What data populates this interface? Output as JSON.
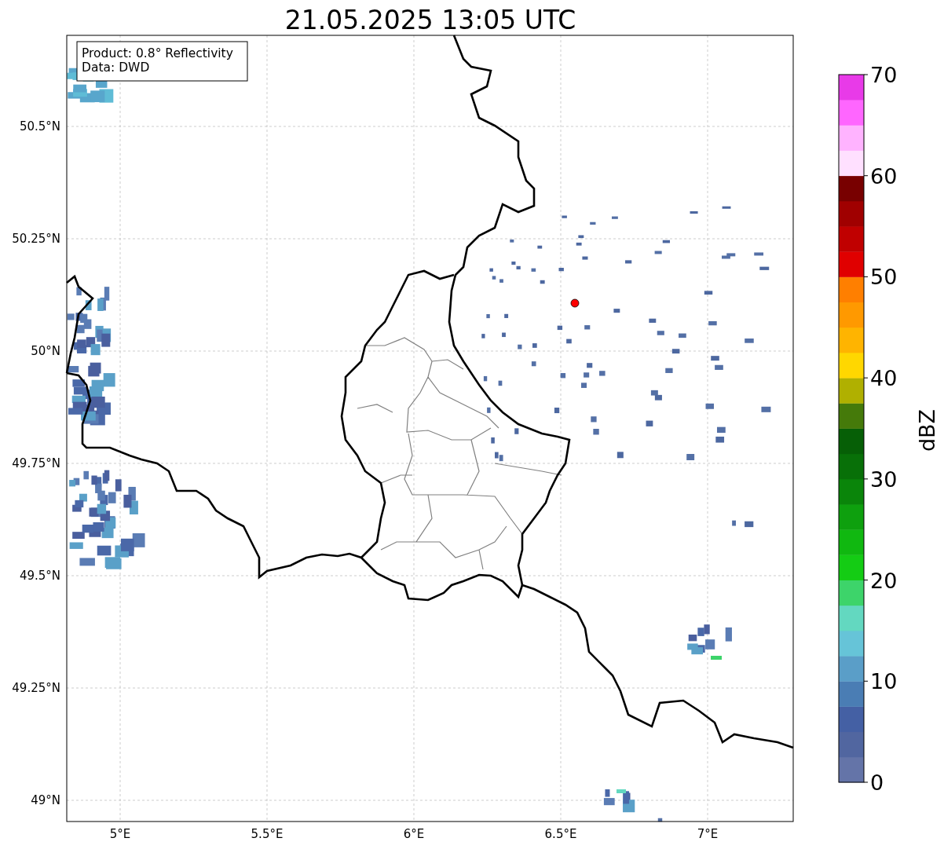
{
  "title": "21.05.2025 13:05 UTC",
  "info_box": [
    "Product: 0.8° Reflectivity",
    "Data: DWD"
  ],
  "x_ticks": [
    "5°E",
    "5.5°E",
    "6°E",
    "6.5°E",
    "7°E"
  ],
  "y_ticks": [
    "50.5°N",
    "50.25°N",
    "50°N",
    "49.75°N",
    "49.5°N",
    "49.25°N",
    "49°N"
  ],
  "colorbar": {
    "label": "dBZ",
    "ticks": [
      "70",
      "60",
      "50",
      "40",
      "30",
      "20",
      "10",
      "0"
    ],
    "bins": [
      {
        "color": "#6474a8"
      },
      {
        "color": "#5166a0"
      },
      {
        "color": "#4460a4"
      },
      {
        "color": "#4a7db4"
      },
      {
        "color": "#5a9ec8"
      },
      {
        "color": "#66c4d8"
      },
      {
        "color": "#63d8c0"
      },
      {
        "color": "#3dd46a"
      },
      {
        "color": "#14cc14"
      },
      {
        "color": "#10b810"
      },
      {
        "color": "#0ea00e"
      },
      {
        "color": "#0a850a"
      },
      {
        "color": "#087008"
      },
      {
        "color": "#065f06"
      },
      {
        "color": "#457a0a"
      },
      {
        "color": "#b0b000"
      },
      {
        "color": "#ffd700"
      },
      {
        "color": "#ffb400"
      },
      {
        "color": "#ff9900"
      },
      {
        "color": "#ff7f00"
      },
      {
        "color": "#e00000"
      },
      {
        "color": "#c00000"
      },
      {
        "color": "#a00000"
      },
      {
        "color": "#780000"
      },
      {
        "color": "#ffe0ff"
      },
      {
        "color": "#ffb3ff"
      },
      {
        "color": "#ff66ff"
      },
      {
        "color": "#e83ae8"
      }
    ]
  }
}
